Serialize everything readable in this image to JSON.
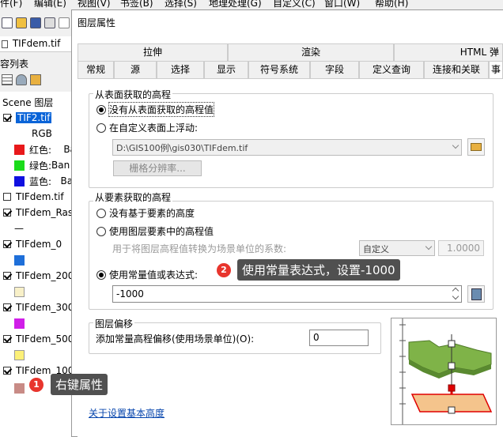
{
  "menubar": {
    "items": [
      "件(F)",
      "编辑(E)",
      "视图(V)",
      "书签(B)",
      "选择(S)",
      "地理处理(G)",
      "自定义(C)",
      "窗口(W)",
      "帮助(H)"
    ]
  },
  "doc_tab": {
    "label": "TIFdem.tif"
  },
  "toc": {
    "title_partial": "容列表",
    "header": "Scene 图层",
    "layers": [
      {
        "name": "TIF2.tif",
        "checked": true,
        "selected": true
      },
      {
        "name": "RGB",
        "checked": null
      },
      {
        "name": "红色:",
        "suffix": "Ba",
        "color": "#e8191b"
      },
      {
        "name": "绿色:",
        "suffix": "Ban",
        "color": "#1adb1a"
      },
      {
        "name": "蓝色:",
        "suffix": "Ba",
        "color": "#1010e0"
      },
      {
        "name": "TIFdem.tif",
        "checked": false
      },
      {
        "name": "TIFdem_Ras",
        "checked": true
      },
      {
        "name": "—",
        "checked": null
      },
      {
        "name": "TIFdem_0",
        "checked": true
      },
      {
        "name": "",
        "color": "#1e6fd9"
      },
      {
        "name": "TIFdem_200",
        "checked": true
      },
      {
        "name": "",
        "color": "#f8f0c8"
      },
      {
        "name": "TIFdem_300",
        "checked": true
      },
      {
        "name": "",
        "color": "#d01ee8"
      },
      {
        "name": "TIFdem_500",
        "checked": true
      },
      {
        "name": "",
        "color": "#fcf078"
      },
      {
        "name": "TIFdem_100",
        "checked": true
      },
      {
        "name": "",
        "color": "#c88b86"
      }
    ]
  },
  "dialog": {
    "title": "图层属性",
    "tabs_row1": [
      "拉伸",
      "渲染",
      "HTML 弹"
    ],
    "tabs_row2": [
      "常规",
      "源",
      "选择",
      "显示",
      "符号系统",
      "字段",
      "定义查询",
      "连接和关联",
      "事"
    ],
    "surface_group": {
      "title": "从表面获取的高程",
      "option_none": "没有从表面获取的高程值",
      "option_float": "在自定义表面上浮动:",
      "surface_path": "D:\\GIS100例\\gis030\\TIFdem.tif",
      "raster_resolution_button": "栅格分辨率..."
    },
    "feature_group": {
      "title": "从要素获取的高程",
      "option_none": "没有基于要素的高度",
      "option_layer_value": "使用图层要素中的高程值",
      "conversion_label": "用于将图层高程值转换为场景单位的系数:",
      "conversion_unit": "自定义",
      "conversion_factor": "1.0000",
      "option_constant": "使用常量值或表达式:",
      "constant_value": "-1000"
    },
    "offset_group": {
      "title": "图层偏移",
      "label": "添加常量高程偏移(使用场景单位)(O):",
      "value": "0"
    },
    "help_link": "关于设置基本高度"
  },
  "annotations": {
    "step1": {
      "number": "1",
      "text": "右键属性"
    },
    "step2": {
      "number": "2",
      "text": "使用常量表达式，设置-1000"
    }
  },
  "colors": {
    "badge": "#e8352d",
    "callout_bg": "#505050",
    "selection": "#0a64d8",
    "link": "#0645ad"
  }
}
